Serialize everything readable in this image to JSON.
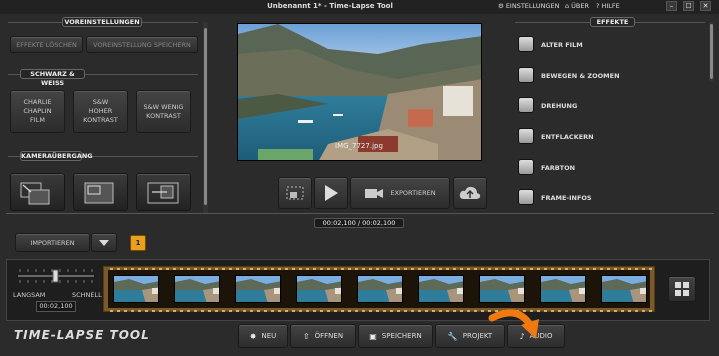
{
  "window": {
    "title": "Unbenannt 1* - Time-Lapse Tool",
    "links": {
      "settings": "EINSTELLUNGEN",
      "about": "ÜBER",
      "help": "HILFE"
    },
    "buttons": {
      "minimize": "–",
      "maximize": "☐",
      "close": "✕"
    }
  },
  "left_panel": {
    "presets_header": "VOREINSTELLUNGEN",
    "delete_effects": "EFFEKTE LÖSCHEN",
    "save_preset": "VOREINSTELLUNG SPEICHERN",
    "bw_header": "SCHWARZ & WEISS",
    "bw_buttons": [
      {
        "line1": "CHARLIE",
        "line2": "CHAPLIN",
        "line3": "FILM"
      },
      {
        "line1": "S&W",
        "line2": "HOHER",
        "line3": "KONTRAST"
      },
      {
        "line1": "S&W WENIG",
        "line2": "KONTRAST",
        "line3": ""
      }
    ],
    "transition_header": "KAMERAÜBERGANG"
  },
  "preview": {
    "filename": "IMG_7727.jpg"
  },
  "transport": {
    "export_label": "EXPORTIEREN"
  },
  "effects_panel": {
    "header": "EFFEKTE",
    "items": [
      "ALTER FILM",
      "BEWEGEN & ZOOMEN",
      "DREHUNG",
      "ENTFLACKERN",
      "FARBTON",
      "FRAME-INFOS"
    ]
  },
  "timeline": {
    "time": "00:02,100  /  00:02,100",
    "import_label": "IMPORTIEREN",
    "badge": "1",
    "speed_slow": "LANGSAM",
    "speed_fast": "SCHNELL",
    "speed_value": "00:02,100"
  },
  "bottom_bar": {
    "logo": "TIME-LAPSE TOOL",
    "new": "NEU",
    "open": "ÖFFNEN",
    "save": "SPEICHERN",
    "project": "PROJEKT",
    "audio": "AUDIO"
  },
  "colors": {
    "accent_orange": "#f07a10",
    "badge": "#e8a020",
    "film": "#7a5a2a"
  }
}
